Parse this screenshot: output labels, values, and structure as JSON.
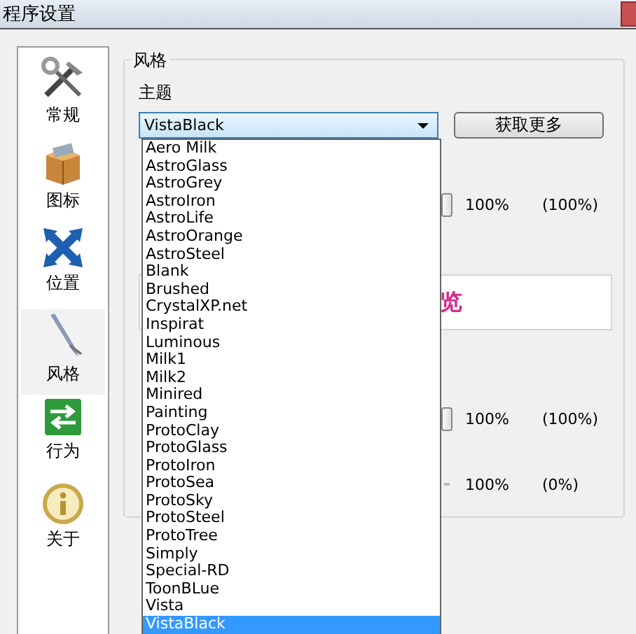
{
  "window": {
    "title": "程序设置"
  },
  "sidebar": {
    "items": [
      {
        "label": "常规",
        "kind": "tools",
        "selected": false
      },
      {
        "label": "图标",
        "kind": "box",
        "selected": false
      },
      {
        "label": "位置",
        "kind": "move",
        "selected": false
      },
      {
        "label": "风格",
        "kind": "pen",
        "selected": true
      },
      {
        "label": "行为",
        "kind": "switch",
        "selected": false
      },
      {
        "label": "关于",
        "kind": "info",
        "selected": false
      }
    ]
  },
  "group": {
    "title": "风格",
    "theme_label": "主题",
    "theme_value": "VistaBlack",
    "more_button": "获取更多",
    "sliders": [
      {
        "value": "100%",
        "effective": "(100%)",
        "thumb": true
      },
      {
        "value": "100%",
        "effective": "(100%)",
        "thumb": true
      },
      {
        "value": "100%",
        "effective": "(0%)",
        "thumb": false
      }
    ],
    "preview_text": "览"
  },
  "dropdown": {
    "items": [
      {
        "label": "Aero Milk",
        "selected": false
      },
      {
        "label": "AstroGlass",
        "selected": false
      },
      {
        "label": "AstroGrey",
        "selected": false
      },
      {
        "label": "AstroIron",
        "selected": false
      },
      {
        "label": "AstroLife",
        "selected": false
      },
      {
        "label": "AstroOrange",
        "selected": false
      },
      {
        "label": "AstroSteel",
        "selected": false
      },
      {
        "label": "Blank",
        "selected": false
      },
      {
        "label": "Brushed",
        "selected": false
      },
      {
        "label": "CrystalXP.net",
        "selected": false
      },
      {
        "label": "Inspirat",
        "selected": false
      },
      {
        "label": "Luminous",
        "selected": false
      },
      {
        "label": "Milk1",
        "selected": false
      },
      {
        "label": "Milk2",
        "selected": false
      },
      {
        "label": "Minired",
        "selected": false
      },
      {
        "label": "Painting",
        "selected": false
      },
      {
        "label": "ProtoClay",
        "selected": false
      },
      {
        "label": "ProtoGlass",
        "selected": false
      },
      {
        "label": "ProtoIron",
        "selected": false
      },
      {
        "label": "ProtoSea",
        "selected": false
      },
      {
        "label": "ProtoSky",
        "selected": false
      },
      {
        "label": "ProtoSteel",
        "selected": false
      },
      {
        "label": "ProtoTree",
        "selected": false
      },
      {
        "label": "Simply",
        "selected": false
      },
      {
        "label": "Special-RD",
        "selected": false
      },
      {
        "label": "ToonBLue",
        "selected": false
      },
      {
        "label": "Vista",
        "selected": false
      },
      {
        "label": "VistaBlack",
        "selected": true
      }
    ]
  }
}
